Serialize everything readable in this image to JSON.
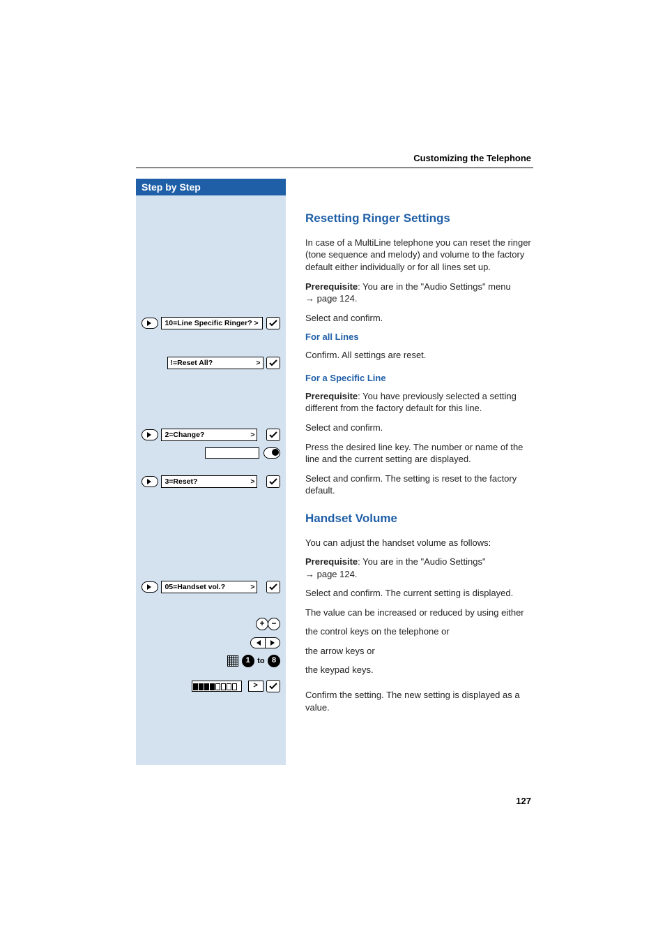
{
  "header": "Customizing the Telephone",
  "sidebar": {
    "title": "Step by Step"
  },
  "pageNumber": "127",
  "s1": {
    "title": "Resetting Ringer Settings",
    "intro": "In case of a MultiLine telephone you can reset the ringer (tone sequence and melody) and volume to the factory default either individually or for all lines set up.",
    "prereqLabel": "Prerequisite",
    "prereqText": ": You are in the \"Audio Settings\" menu",
    "pageRef": "→ page 124.",
    "selectConfirm": "Select and confirm.",
    "lcd1": "10=Line Specific Ringer? >",
    "sub1": "For all Lines",
    "confirmReset": "Confirm. All settings are reset.",
    "lcd2": "!=Reset All?",
    "sub2": "For a Specific Line",
    "prereq2Text": ": You have previously selected a setting different from the factory default for this line.",
    "lcd3": "2=Change?",
    "linePress": "Press the desired line key. The number or name of the line and the current setting are displayed.",
    "lcd4": "3=Reset?",
    "resetFactory": "Select and confirm. The setting is reset to the factory default."
  },
  "s2": {
    "title": "Handset Volume",
    "intro": "You can adjust the handset volume as follows:",
    "prereqLabel": "Prerequisite",
    "prereqText": ": You are in the \"Audio Settings\"",
    "pageRef": "→ page 124.",
    "selectDisplay": "Select and confirm. The current setting is displayed.",
    "lcd1": "05=Handset vol.?",
    "valueText": "The value can be increased or reduced by using either",
    "controlKeys": "the control keys on the telephone or",
    "arrowKeys": "the arrow keys or",
    "keypad": "the keypad keys.",
    "to": "to",
    "confirmNew": "Confirm the setting. The new setting is displayed as a value."
  }
}
